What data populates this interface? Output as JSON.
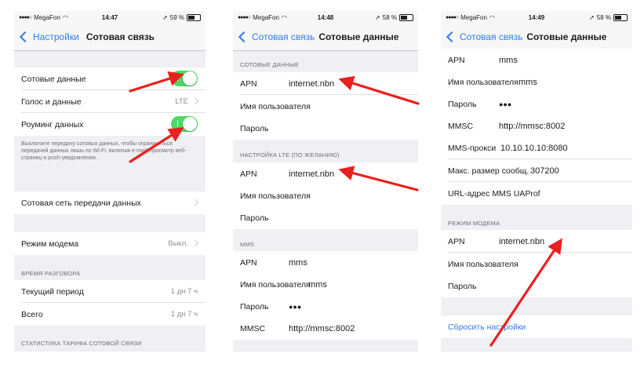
{
  "colors": {
    "accent": "#2f7de1",
    "toggle_on": "#4cd964",
    "arrow": "#e8201e"
  },
  "screen1": {
    "status": {
      "carrier": "MegaFon",
      "time": "14:47",
      "battery": "59 %",
      "battery_level": 0.59
    },
    "nav": {
      "back": "Настройки",
      "title": "Сотовая связь"
    },
    "rows": {
      "cellular_data": "Сотовые данные",
      "voice_data": "Голос и данные",
      "voice_data_value": "LTE",
      "roaming": "Роуминг данных",
      "network": "Сотовая сеть передачи данных",
      "hotspot": "Режим модема",
      "hotspot_value": "Выкл.",
      "current": "Текущий период",
      "current_value": "1 дн 7 ч",
      "total": "Всего",
      "total_value": "1 дн 7 ч"
    },
    "toggles": {
      "cellular_data": true,
      "roaming": true
    },
    "footer": "Выключите передачу сотовых данных, чтобы ограничиться передачей данных лишь по Wi-Fi, включая e-mail, просмотр веб-страниц и push-уведомления.",
    "headers": {
      "talk_time": "ВРЕМЯ РАЗГОВОРА",
      "stats": "СТАТИСТИКА ТАРИФА СОТОВОЙ СВЯЗИ"
    }
  },
  "screen2": {
    "status": {
      "carrier": "MegaFon",
      "time": "14:48",
      "battery": "58 %",
      "battery_level": 0.58
    },
    "nav": {
      "back": "Сотовая связь",
      "title": "Сотовые данные"
    },
    "headers": {
      "cellular": "СОТОВЫЕ ДАННЫЕ",
      "lte": "НАСТРОЙКА LTE (ПО ЖЕЛАНИЮ)",
      "mms": "MMS"
    },
    "labels": {
      "apn": "APN",
      "user": "Имя пользователя",
      "password": "Пароль",
      "mmsc": "MMSC"
    },
    "values": {
      "apn1": "internet.nbn",
      "apn2": "internet.nbn",
      "mms_apn": "mms",
      "mms_user": "mms",
      "mms_password": "●●●",
      "mmsc": "http://mmsc:8002"
    }
  },
  "screen3": {
    "status": {
      "carrier": "MegaFon",
      "time": "14:49",
      "battery": "58 %",
      "battery_level": 0.58
    },
    "nav": {
      "back": "Сотовая связь",
      "title": "Сотовые данные"
    },
    "labels": {
      "apn": "APN",
      "user": "Имя пользователя",
      "password": "Пароль",
      "mmsc": "MMSC",
      "proxy": "MMS-прокси",
      "maxsize": "Макс. размер сообщ.",
      "uaprof": "URL-адрес MMS UAProf"
    },
    "values": {
      "mms_apn": "mms",
      "mms_user": "mms",
      "mms_password": "●●●",
      "mmsc": "http://mmsc:8002",
      "proxy": "10.10.10.10:8080",
      "maxsize": "307200",
      "modem_apn": "internet.nbn"
    },
    "headers": {
      "modem": "РЕЖИМ МОДЕМА"
    },
    "reset": "Сбросить настройки"
  }
}
